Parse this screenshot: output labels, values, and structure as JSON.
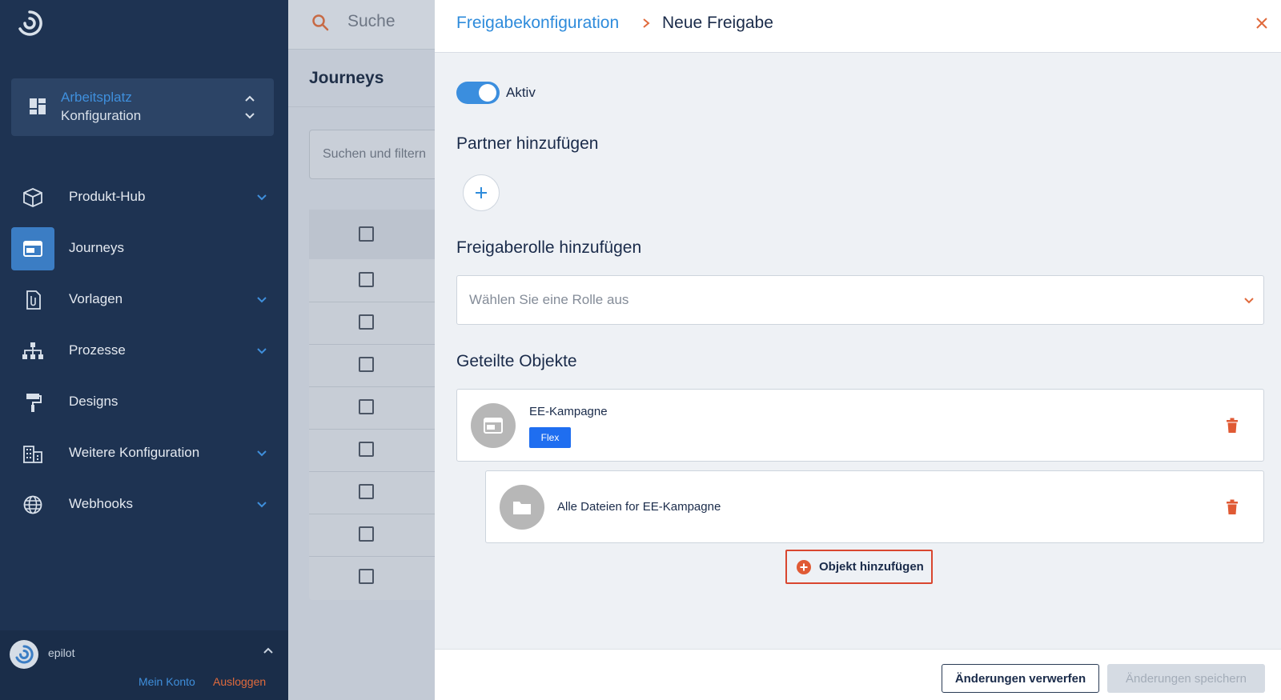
{
  "sidebar": {
    "workspace": {
      "title": "Arbeitsplatz",
      "subtitle": "Konfiguration"
    },
    "items": [
      {
        "label": "Produkt-Hub",
        "icon": "cube-icon",
        "expandable": true,
        "active": false
      },
      {
        "label": "Journeys",
        "icon": "journey-window-icon",
        "expandable": false,
        "active": true
      },
      {
        "label": "Vorlagen",
        "icon": "template-document-icon",
        "expandable": true,
        "active": false
      },
      {
        "label": "Prozesse",
        "icon": "process-tree-icon",
        "expandable": true,
        "active": false
      },
      {
        "label": "Designs",
        "icon": "paint-roller-icon",
        "expandable": false,
        "active": false
      },
      {
        "label": "Weitere Konfiguration",
        "icon": "building-icon",
        "expandable": true,
        "active": false
      },
      {
        "label": "Webhooks",
        "icon": "globe-icon",
        "expandable": true,
        "active": false
      }
    ],
    "footer": {
      "user": "epilot",
      "account_link": "Mein Konto",
      "logout_link": "Ausloggen"
    }
  },
  "main": {
    "search_placeholder": "Suche",
    "page_title": "Journeys",
    "filter_placeholder": "Suchen und filtern",
    "table_rows": 8
  },
  "drawer": {
    "breadcrumb": {
      "parent": "Freigabekonfiguration",
      "current": "Neue Freigabe"
    },
    "toggle": {
      "label": "Aktiv",
      "on": true
    },
    "partner_section": {
      "title": "Partner hinzufügen"
    },
    "role_section": {
      "title": "Freigaberolle hinzufügen",
      "placeholder": "Wählen Sie eine Rolle aus"
    },
    "objects_section": {
      "title": "Geteilte Objekte",
      "objects": [
        {
          "name": "EE-Kampagne",
          "badge": "Flex",
          "icon": "journey-window-icon"
        },
        {
          "name": "Alle Dateien for EE-Kampagne",
          "icon": "folder-icon"
        }
      ],
      "add_button": "Objekt hinzufügen"
    },
    "footer": {
      "discard": "Änderungen verwerfen",
      "save": "Änderungen speichern"
    }
  },
  "colors": {
    "sidebar_bg": "#1e3352",
    "accent_blue": "#2e8bdb",
    "danger_orange": "#e05a34",
    "badge_blue": "#1f6ef0"
  }
}
